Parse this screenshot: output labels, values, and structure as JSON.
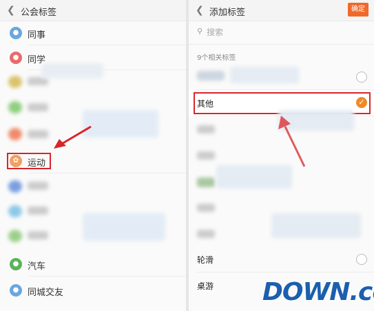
{
  "left_panel": {
    "title": "公会标签",
    "items": [
      {
        "label": "同事",
        "icon": "group-icon",
        "color": "#6aa7e0"
      },
      {
        "label": "同学",
        "icon": "school-icon",
        "color": "#e86b6b"
      },
      {
        "label": "运动",
        "icon": "sports-icon",
        "color": "#f0a060"
      },
      {
        "label": "汽车",
        "icon": "car-icon",
        "color": "#5bb35b"
      },
      {
        "label": "同城交友",
        "icon": "location-icon",
        "color": "#6aa7e0"
      }
    ]
  },
  "right_panel": {
    "title": "添加标签",
    "confirm_label": "确定",
    "search_placeholder": "搜索",
    "section_label": "9个相关标签",
    "items": [
      {
        "label": "其他",
        "checked": true
      },
      {
        "label": "轮滑",
        "checked": false
      },
      {
        "label": "桌游",
        "checked": false
      }
    ]
  },
  "watermark": "DOWN.cc",
  "colors": {
    "accent": "#ef6a2a",
    "highlight_box": "#d9252a",
    "arrow": "#d9252a"
  }
}
